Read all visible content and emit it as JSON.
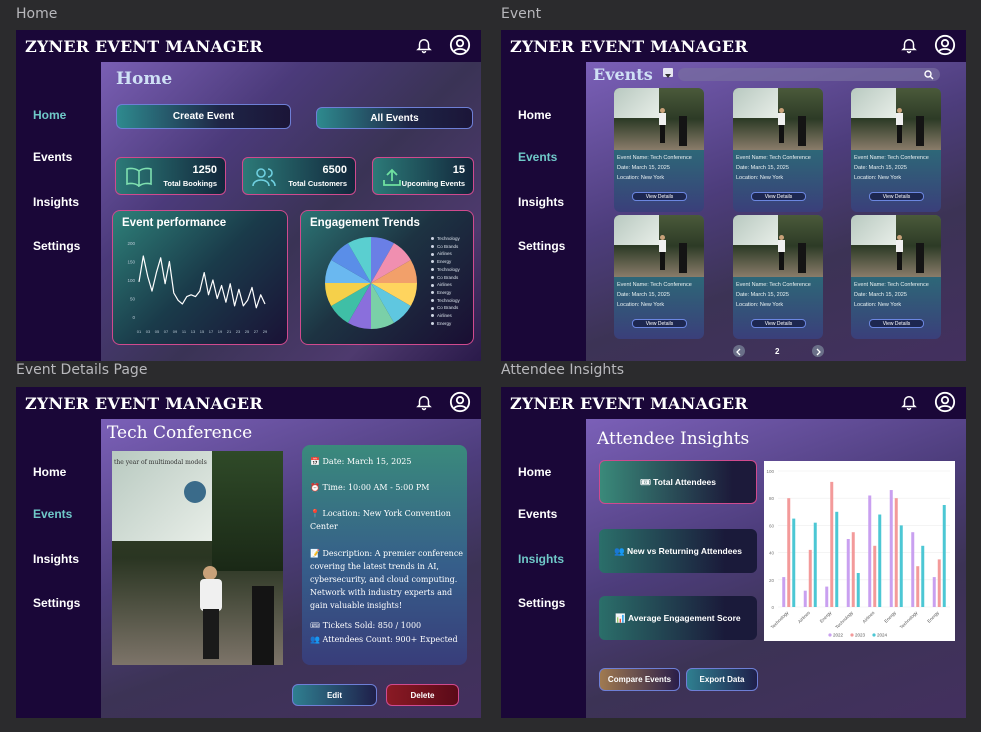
{
  "app": {
    "brand": "ZYNER EVENT MANAGER"
  },
  "frames": {
    "home": "Home",
    "event": "Event",
    "details": "Event Details Page",
    "insights": "Attendee Insights"
  },
  "nav": {
    "home": "Home",
    "events": "Events",
    "insights": "Insights",
    "settings": "Settings"
  },
  "home": {
    "title": "Home",
    "create_event": "Create Event",
    "all_events": "All Events",
    "stats": [
      {
        "value": "1250",
        "label": "Total Bookings",
        "icon": "book-icon"
      },
      {
        "value": "6500",
        "label": "Total Customers",
        "icon": "users-icon"
      },
      {
        "value": "15",
        "label": "Upcoming Events",
        "icon": "upload-icon"
      }
    ],
    "performance": {
      "title": "Event performance",
      "y_ticks": [
        "200",
        "150",
        "100",
        "50",
        "0"
      ],
      "x_ticks": [
        "01",
        "03",
        "05",
        "07",
        "09",
        "11",
        "13",
        "15",
        "17",
        "19",
        "21",
        "23",
        "25",
        "27",
        "29"
      ]
    },
    "engagement": {
      "title": "Engagement Trends",
      "legend": [
        "Technology",
        "Co Brands",
        "Airlines",
        "Energy",
        "Technology",
        "Co Brands",
        "Airlines",
        "Energy",
        "Technology",
        "Co Brands",
        "Airlines",
        "Energy"
      ]
    }
  },
  "chart_data": [
    {
      "type": "line",
      "title": "Event performance",
      "x": [
        "01",
        "02",
        "03",
        "04",
        "05",
        "06",
        "07",
        "08",
        "09",
        "10",
        "11",
        "12",
        "13",
        "14",
        "15",
        "16",
        "17",
        "18",
        "19",
        "20",
        "21",
        "22",
        "23",
        "24",
        "25",
        "26",
        "27",
        "28",
        "29",
        "30"
      ],
      "series": [
        {
          "values": [
            95,
            165,
            110,
            70,
            120,
            160,
            90,
            150,
            65,
            45,
            35,
            55,
            60,
            55,
            70,
            120,
            60,
            100,
            50,
            85,
            40,
            90,
            30,
            75,
            30,
            45,
            80,
            25,
            60,
            35
          ]
        }
      ],
      "ylim": [
        0,
        200
      ],
      "grid": false
    },
    {
      "type": "pie",
      "title": "Engagement Trends",
      "labels": [
        "Technology",
        "Co Brands",
        "Airlines",
        "Energy",
        "Technology",
        "Co Brands",
        "Airlines",
        "Energy",
        "Technology",
        "Co Brands",
        "Airlines",
        "Energy"
      ],
      "values": [
        1,
        1,
        1,
        1,
        1,
        1,
        1,
        1,
        1,
        1,
        1,
        1
      ],
      "colors": [
        "#6a7fe6",
        "#f08fb0",
        "#f2a06a",
        "#ffd45e",
        "#5fc7e0",
        "#7ad0a8",
        "#8a6fdc",
        "#3fbfa6",
        "#f5d04a",
        "#6ab8f0",
        "#5a8ee8",
        "#5acfd0"
      ]
    },
    {
      "type": "bar",
      "categories": [
        "Technology",
        "Airlines",
        "Energy",
        "Technology",
        "Airlines",
        "Energy",
        "Technology",
        "Energy"
      ],
      "series": [
        {
          "name": "2022",
          "values": [
            22,
            12,
            15,
            50,
            82,
            86,
            55,
            22
          ]
        },
        {
          "name": "2023",
          "values": [
            80,
            42,
            92,
            55,
            45,
            80,
            30,
            35
          ]
        },
        {
          "name": "2024",
          "values": [
            65,
            62,
            70,
            25,
            68,
            60,
            45,
            75
          ]
        }
      ],
      "ylim": [
        0,
        100
      ],
      "y_ticks": [
        "100",
        "80",
        "60",
        "40",
        "20",
        "0"
      ],
      "legend_position": "bottom",
      "colors": [
        "#c9a0f0",
        "#f39a9a",
        "#4cc7d4"
      ]
    }
  ],
  "events_page": {
    "title": "Events",
    "filter_icon": "filter-icon",
    "search_icon": "search-icon",
    "cards": [
      {
        "name": "Event Name:  Tech Conference",
        "date": "Date:  March 15, 2025",
        "location": "Location:  New York",
        "button": "View Details"
      },
      {
        "name": "Event Name:  Tech Conference",
        "date": "Date:  March 15, 2025",
        "location": "Location:  New York",
        "button": "View Details"
      },
      {
        "name": "Event Name:  Tech Conference",
        "date": "Date:  March 15, 2025",
        "location": "Location:  New York",
        "button": "View Details"
      },
      {
        "name": "Event Name:  Tech Conference",
        "date": "Date:  March 15, 2025",
        "location": "Location:  New York",
        "button": "View Details"
      },
      {
        "name": "Event Name:  Tech Conference",
        "date": "Date:  March 15, 2025",
        "location": "Location:  New York",
        "button": "View Details"
      },
      {
        "name": "Event Name:  Tech Conference",
        "date": "Date:  March 15, 2025",
        "location": "Location:  New York",
        "button": "View Details"
      }
    ],
    "page": "2"
  },
  "details": {
    "title": "Tech Conference",
    "slide_text": "the year of multimodal models",
    "date": "📅 Date: March 15, 2025",
    "time": "⏰ Time: 10:00 AM - 5:00 PM",
    "location": "📍 Location: New York Convention Center",
    "description": "📝 Description: A premier conference covering the latest trends in AI, cybersecurity, and cloud computing. Network with industry experts and gain valuable insights!",
    "tickets": "🎟 Tickets Sold: 850 / 1000",
    "attendees": "👥 Attendees Count: 900+ Expected",
    "edit": "Edit",
    "delete": "Delete"
  },
  "insights": {
    "title": "Attendee Insights",
    "cards": [
      "🎟 Total Attendees",
      "👥 New vs Returning Attendees",
      "📊 Average Engagement Score"
    ],
    "compare": "Compare Events",
    "export": "Export Data"
  }
}
